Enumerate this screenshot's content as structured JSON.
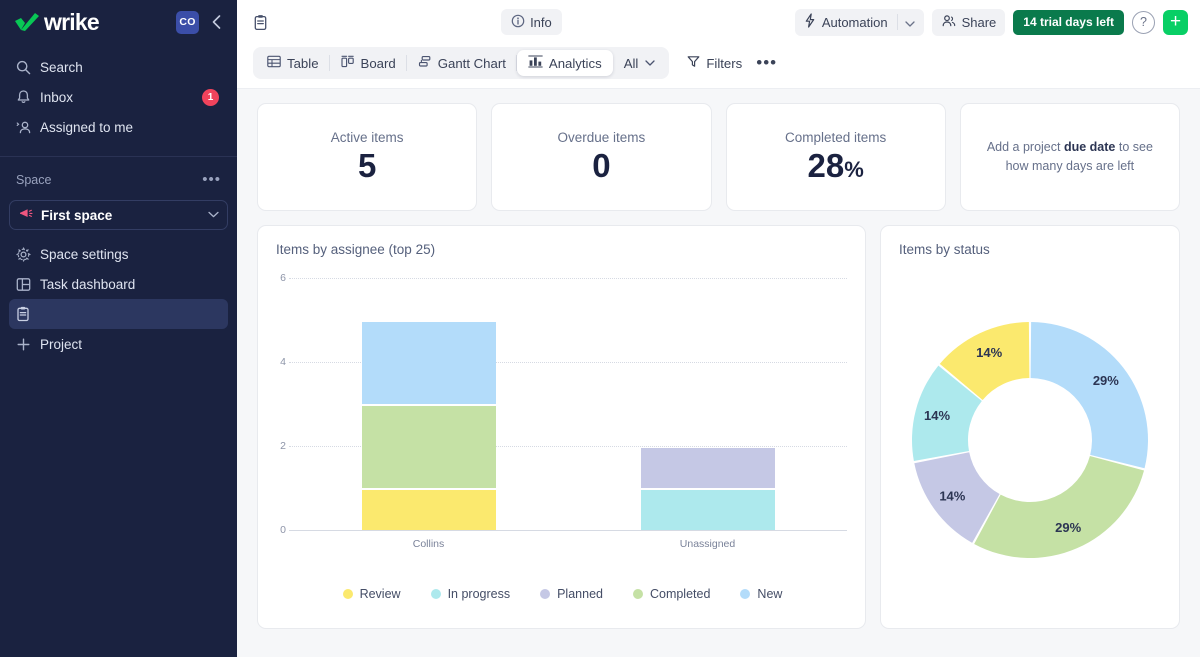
{
  "sidebar": {
    "brand": "wrike",
    "avatar_initials": "CO",
    "collapse_icon": "chevron-left-icon",
    "nav": [
      {
        "label": "Search",
        "icon": "search-icon",
        "badge": ""
      },
      {
        "label": "Inbox",
        "icon": "bell-icon",
        "badge": "1"
      },
      {
        "label": "Assigned to me",
        "icon": "user-check-icon",
        "badge": ""
      }
    ],
    "section_title": "Space",
    "section_more": "•••",
    "space": {
      "name": "First space",
      "icon": "megaphone-icon",
      "chevron": "chevron-down-icon"
    },
    "lower": [
      {
        "label": "Space settings",
        "icon": "gear-icon",
        "active": false
      },
      {
        "label": "Task dashboard",
        "icon": "dashboard-icon",
        "active": false
      },
      {
        "label": "",
        "icon": "clipboard-icon",
        "active": true
      },
      {
        "label": "Project",
        "icon": "plus-icon",
        "active": false
      }
    ]
  },
  "header": {
    "doc_icon": "clipboard-icon",
    "info_label": "Info",
    "info_icon": "info-icon",
    "automation_label": "Automation",
    "automation_icon": "bolt-icon",
    "automation_chevron": "chevron-down-icon",
    "share_label": "Share",
    "share_icon": "people-icon",
    "trial_label": "14 trial days left",
    "help_label": "?",
    "add_label": "+"
  },
  "viewbar": {
    "tabs": [
      {
        "label": "Table",
        "icon": "table-icon",
        "selected": false
      },
      {
        "label": "Board",
        "icon": "board-icon",
        "selected": false
      },
      {
        "label": "Gantt Chart",
        "icon": "gantt-icon",
        "selected": false
      },
      {
        "label": "Analytics",
        "icon": "analytics-icon",
        "selected": true
      },
      {
        "label": "All",
        "icon": "",
        "selected": false
      }
    ],
    "filters_label": "Filters",
    "filters_icon": "funnel-icon",
    "more_label": "•••"
  },
  "kpis": [
    {
      "label": "Active items",
      "value": "5",
      "suffix": ""
    },
    {
      "label": "Overdue items",
      "value": "0",
      "suffix": ""
    },
    {
      "label": "Completed items",
      "value": "28",
      "suffix": "%"
    }
  ],
  "due_date_card": {
    "text_before": "Add a project ",
    "text_bold": "due date",
    "text_after": " to see how many days are left"
  },
  "colors": {
    "review": "#FBE96E",
    "in_progress": "#ADE9ED",
    "planned": "#C5C8E5",
    "completed": "#C5E1A5",
    "new": "#B3DCFA",
    "trial_green": "#0a7a4c",
    "add_green": "#08cf65",
    "sidebar_bg": "#1a2240",
    "accent_blue": "#3b4ea8"
  },
  "chart_data": [
    {
      "type": "bar",
      "title": "Items by assignee (top 25)",
      "stacked": true,
      "xlabel": "",
      "ylabel": "",
      "ylim": [
        0,
        6
      ],
      "yticks": [
        0,
        2,
        4,
        6
      ],
      "grid": true,
      "legend_position": "bottom",
      "categories": [
        "Collins",
        "Unassigned"
      ],
      "series": [
        {
          "name": "Review",
          "color": "#FBE96E",
          "values": [
            1,
            0
          ]
        },
        {
          "name": "In progress",
          "color": "#ADE9ED",
          "values": [
            0,
            1
          ]
        },
        {
          "name": "Planned",
          "color": "#C5C8E5",
          "values": [
            0,
            1
          ]
        },
        {
          "name": "Completed",
          "color": "#C5E1A5",
          "values": [
            2,
            0
          ]
        },
        {
          "name": "New",
          "color": "#B3DCFA",
          "values": [
            2,
            0
          ]
        }
      ],
      "legend": [
        "Review",
        "In progress",
        "Planned",
        "Completed",
        "New"
      ]
    },
    {
      "type": "pie",
      "title": "Items by status",
      "donut": true,
      "labels": [
        "New",
        "Completed",
        "Planned",
        "In progress",
        "Review"
      ],
      "values": [
        29,
        29,
        14,
        14,
        14
      ],
      "value_labels": [
        "29%",
        "29%",
        "14%",
        "14%",
        "14%"
      ],
      "colors": [
        "#B3DCFA",
        "#C5E1A5",
        "#C5C8E5",
        "#ADE9ED",
        "#FBE96E"
      ]
    }
  ]
}
